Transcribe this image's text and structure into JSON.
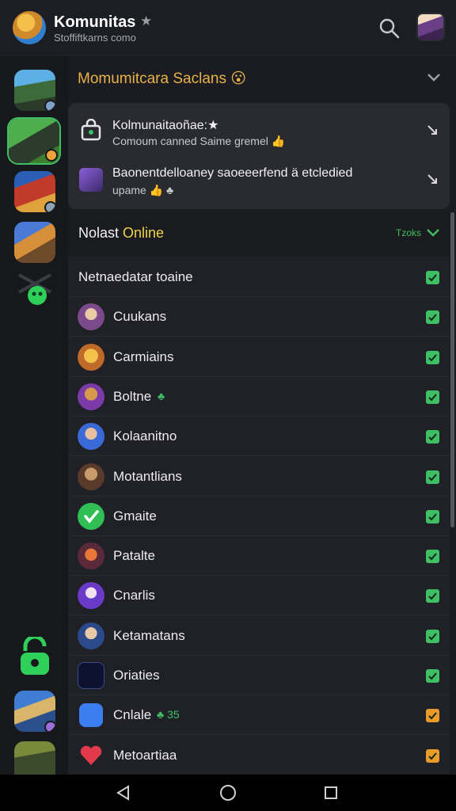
{
  "app": {
    "title": "Komunitas",
    "subtitle": "Stoffiftkarns como"
  },
  "server": {
    "title": "Momumitcara Saclans 😮"
  },
  "announcements": [
    {
      "title": "Kolmunaitaoñae:★",
      "subtitle": "Comoum canned Saime gremel 👍"
    },
    {
      "title": "Baonentdelloaney saoeeerfend ä etcledied",
      "subtitle": "upame 👍 ♣"
    }
  ],
  "online": {
    "title_prefix": "Nolast ",
    "title_highlight": "Online",
    "filter_label": "Tzoks"
  },
  "members": [
    {
      "label": "Netnaedatar toaine",
      "extra": "",
      "status_color": "#3fbf63"
    },
    {
      "label": "Cuukans",
      "extra": "",
      "status_color": "#3fbf63"
    },
    {
      "label": "Carmiains",
      "extra": "",
      "status_color": "#3fbf63"
    },
    {
      "label": "Boltne",
      "extra": "♣",
      "status_color": "#3fbf63"
    },
    {
      "label": "Kolaanitno",
      "extra": "",
      "status_color": "#3fbf63"
    },
    {
      "label": "Motantlians",
      "extra": "",
      "status_color": "#3fbf63"
    },
    {
      "label": "Gmaite",
      "extra": "",
      "status_color": "#3fbf63"
    },
    {
      "label": "Patalte",
      "extra": "",
      "status_color": "#3fbf63"
    },
    {
      "label": "Cnarlis",
      "extra": "",
      "status_color": "#3fbf63"
    },
    {
      "label": "Ketamatans",
      "extra": "",
      "status_color": "#3fbf63"
    },
    {
      "label": "Oriaties",
      "extra": "",
      "status_color": "#3fbf63"
    },
    {
      "label": "Cnlale",
      "extra": "♣ 35",
      "status_color": "#e89a2a"
    },
    {
      "label": "Metoartiaa",
      "extra": "",
      "status_color": "#e89a2a"
    }
  ],
  "colors": {
    "accent_green": "#3fbf63",
    "accent_orange": "#e89a2a",
    "server_title": "#e8b24a"
  }
}
